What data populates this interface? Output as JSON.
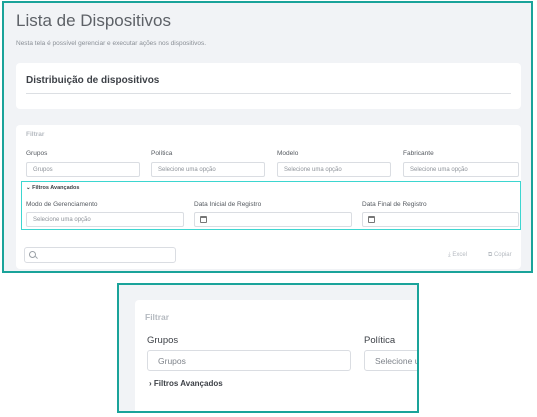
{
  "page": {
    "title": "Lista de Dispositivos",
    "subtitle": "Nesta tela é possível gerenciar e executar ações nos dispositivos."
  },
  "distribution": {
    "title": "Distribuição de dispositivos"
  },
  "filter": {
    "title": "Filtrar",
    "fields": [
      {
        "label": "Grupos",
        "placeholder": "Grupos"
      },
      {
        "label": "Política",
        "placeholder": "Selecione uma opção"
      },
      {
        "label": "Modelo",
        "placeholder": "Selecione uma opção"
      },
      {
        "label": "Fabricante",
        "placeholder": "Selecione uma opção"
      }
    ],
    "advanced": {
      "label": "Filtros Avançados",
      "toggle_expanded": "⌄",
      "fields": [
        {
          "label": "Modo de Gerenciamento",
          "placeholder": "Selecione uma opção"
        },
        {
          "label": "Data Inicial de Registro"
        },
        {
          "label": "Data Final de Registro"
        }
      ]
    }
  },
  "toolbar": {
    "excel": "Excel",
    "copy": "Copiar"
  },
  "zoom": {
    "title": "Filtrar",
    "grupos_label": "Grupos",
    "grupos_placeholder": "Grupos",
    "politica_label": "Política",
    "politica_placeholder": "Selecione uma opção",
    "advanced_label": "Filtros Avançados",
    "toggle_collapsed": "›"
  },
  "colors": {
    "highlight": "#1aa39a",
    "advanced_border": "#3dd6d0",
    "background": "#f1f3f6"
  }
}
